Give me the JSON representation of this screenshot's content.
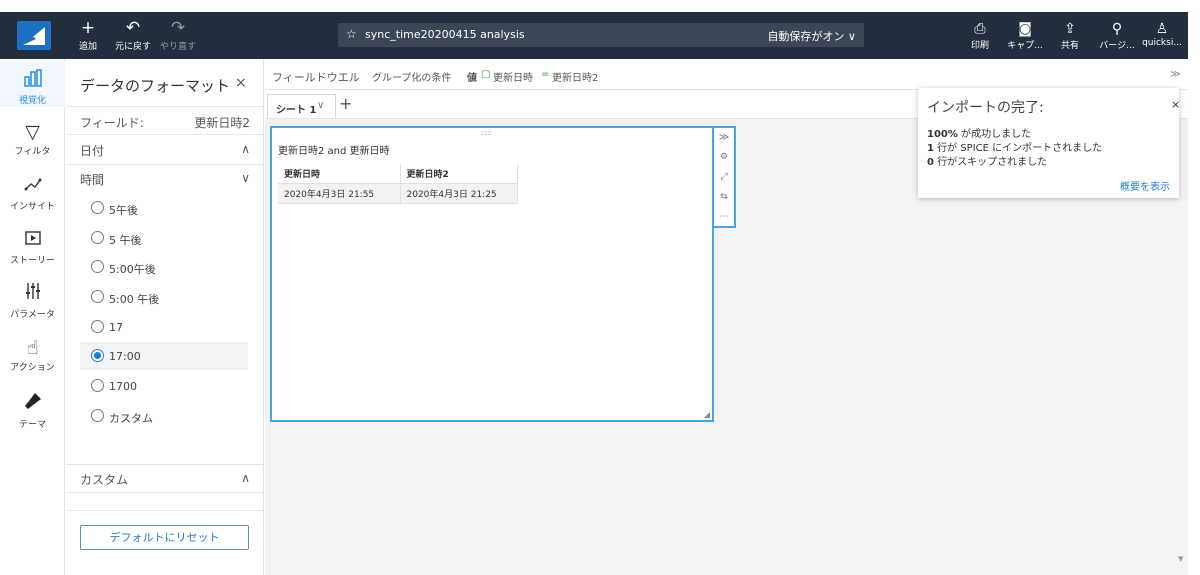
{
  "toolbar": {
    "add_label": "追加",
    "undo_label": "元に戻す",
    "redo_label": "やり直す",
    "title": "sync_time20200415 analysis",
    "autosave": "自動保存がオン ∨",
    "print_label": "印刷",
    "capture_label": "キャプ...",
    "share_label": "共有",
    "version_label": "バージ...",
    "user_label": "quicksi..."
  },
  "rail": {
    "items": [
      {
        "label": "視覚化",
        "icon": "bar-chart-icon"
      },
      {
        "label": "フィルタ",
        "icon": "filter-icon"
      },
      {
        "label": "インサイト",
        "icon": "insight-icon"
      },
      {
        "label": "ストーリー",
        "icon": "story-icon"
      },
      {
        "label": "パラメータ",
        "icon": "parameter-icon"
      },
      {
        "label": "アクション",
        "icon": "action-icon"
      },
      {
        "label": "テーマ",
        "icon": "theme-icon"
      }
    ]
  },
  "panel": {
    "title": "データのフォーマット",
    "close": "×",
    "field_label": "フィールド:",
    "field_value": "更新日時2",
    "date_section": "日付",
    "time_section": "時間",
    "options": [
      "5午後",
      "5 午後",
      "5:00午後",
      "5:00 午後",
      "17",
      "17:00",
      "1700",
      "カスタム"
    ],
    "selected_option": "17:00",
    "custom_section": "カスタム",
    "reset_button": "デフォルトにリセット"
  },
  "fieldwell": {
    "label": "フィールドウエル",
    "group_label": "グループ化の条件",
    "value_label": "値",
    "field1": "更新日時",
    "field2": "更新日時2"
  },
  "sheets": {
    "tab_label": "シート 1",
    "add": "+"
  },
  "visual": {
    "title": "更新日時2 and 更新日時",
    "columns": [
      "更新日時",
      "更新日時2"
    ],
    "rows": [
      [
        "2020年4月3日 21:55",
        "2020年4月3日 21:25"
      ]
    ]
  },
  "toast": {
    "title": "インポートの完了:",
    "close": "×",
    "line1_num": "100%",
    "line1_text": " が成功しました",
    "line2_num": "1",
    "line2_text": " 行が SPICE にインポートされました",
    "line3_num": "0",
    "line3_text": " 行がスキップされました",
    "link": "概要を表示"
  },
  "colors": {
    "topbar": "#232f3e",
    "accent": "#4aa3df",
    "link": "#2a7bd0"
  }
}
